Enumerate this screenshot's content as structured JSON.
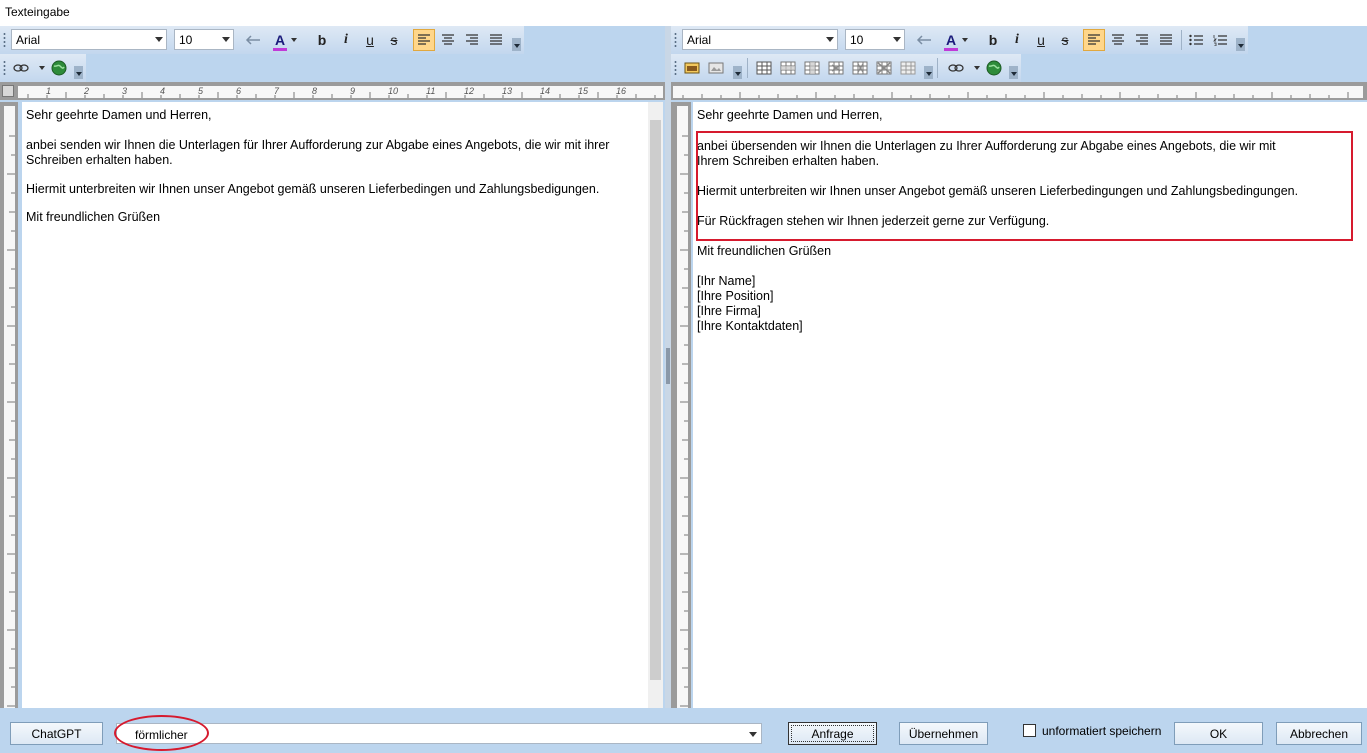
{
  "window": {
    "title": "Texteingabe"
  },
  "toolbar": {
    "font_name": "Arial",
    "font_size": "10",
    "bold": "b",
    "italic": "i",
    "underline": "u",
    "strike": "s",
    "text_color": "A"
  },
  "ruler_ticks": [
    "1",
    "2",
    "3",
    "4",
    "5",
    "6",
    "7",
    "8",
    "9",
    "10",
    "11",
    "12",
    "13",
    "14",
    "15",
    "16"
  ],
  "left_doc": {
    "lines": [
      "Sehr geehrte Damen und Herren,",
      "",
      "anbei senden wir Ihnen die Unterlagen für Ihrer Aufforderung zur Abgabe eines Angebots, die wir mit ihrer",
      "Schreiben erhalten haben.",
      "",
      "Hiermit unterbreiten wir Ihnen unser Angebot gemäß unseren Lieferbedingen und Zahlungsbedigungen.",
      "",
      "Mit freundlichen Grüßen"
    ]
  },
  "right_doc": {
    "lines": [
      "Sehr geehrte Damen und Herren,",
      "",
      "anbei übersenden wir Ihnen die Unterlagen zu Ihrer Aufforderung zur Abgabe eines Angebots, die wir mit",
      "Ihrem Schreiben erhalten haben.",
      "",
      "Hiermit unterbreiten wir Ihnen unser Angebot gemäß unseren Lieferbedingungen und Zahlungsbedingungen.",
      "",
      "Für Rückfragen stehen wir Ihnen jederzeit gerne zur Verfügung.",
      "",
      "Mit freundlichen Grüßen",
      "",
      "[Ihr Name]",
      "[Ihre Position]",
      "[Ihre Firma]",
      "[Ihre Kontaktdaten]"
    ]
  },
  "bottom": {
    "chatgpt_label": "ChatGPT",
    "prompt_value": "förmlicher",
    "request_label": "Anfrage",
    "apply_label": "Übernehmen",
    "unformatted_label": "unformatiert speichern",
    "ok_label": "OK",
    "cancel_label": "Abbrechen"
  },
  "colors": {
    "accent_red": "#d61a2e",
    "toolbar_bg": "#bcd5ee",
    "active_button": "#ffd68a"
  }
}
